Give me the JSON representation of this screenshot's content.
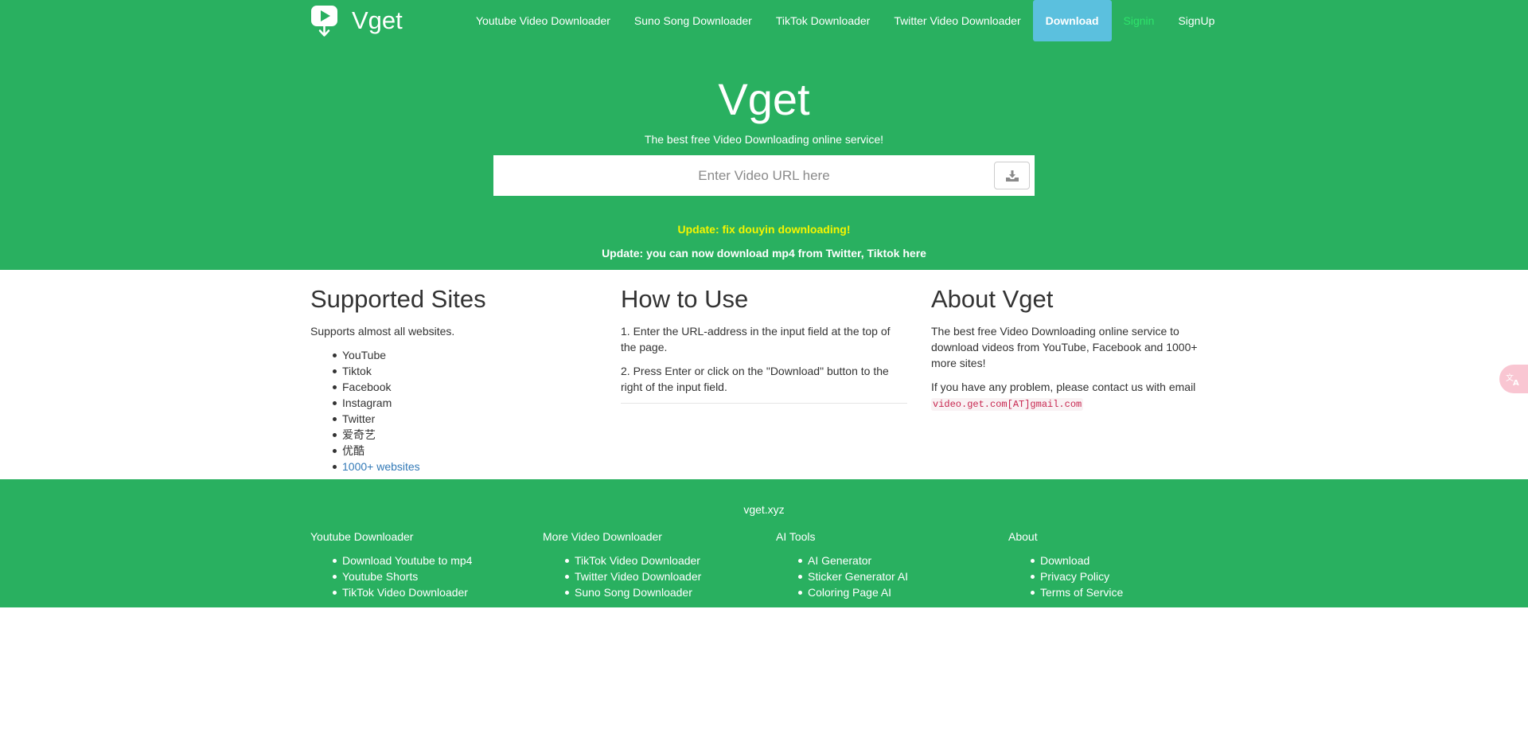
{
  "brand": {
    "name": "Vget",
    "logo_icon": "play-download-icon"
  },
  "nav": {
    "links": [
      "Youtube Video Downloader",
      "Suno Song Downloader",
      "TikTok Downloader",
      "Twitter Video Downloader"
    ],
    "download": "Download",
    "signin": "Signin",
    "signup": "SignUp"
  },
  "hero": {
    "title": "Vget",
    "subtitle": "The best free Video Downloading online service!",
    "search_placeholder": "Enter Video URL here",
    "search_button_icon": "download-tray-icon",
    "update1": "Update: fix douyin downloading!",
    "update2": "Update: you can now download mp4 from Twitter, Tiktok here"
  },
  "supported": {
    "title": "Supported Sites",
    "intro": "Supports almost all websites.",
    "sites": [
      "YouTube",
      "Tiktok",
      "Facebook",
      "Instagram",
      "Twitter",
      "爱奇艺",
      "优酷"
    ],
    "more_link": "1000+ websites"
  },
  "howto": {
    "title": "How to Use",
    "steps": [
      "1. Enter the URL-address in the input field at the top of the page.",
      "2. Press Enter or click on the \"Download\" button to the right of the input field."
    ]
  },
  "about": {
    "title": "About Vget",
    "description": "The best free Video Downloading online service to download videos from YouTube, Facebook and 1000+ more sites!",
    "contact_prefix": "If you have any problem, please contact us with email",
    "email": "video.get.com[AT]gmail.com"
  },
  "translate_icon": "translate-icon",
  "footer": {
    "site": "vget.xyz",
    "columns": [
      {
        "title": "Youtube Downloader",
        "links": [
          "Download Youtube to mp4",
          "Youtube Shorts",
          "TikTok Video Downloader"
        ]
      },
      {
        "title": "More Video Downloader",
        "links": [
          "TikTok Video Downloader",
          "Twitter Video Downloader",
          "Suno Song Downloader"
        ]
      },
      {
        "title": "AI Tools",
        "links": [
          "AI Generator",
          "Sticker Generator AI",
          "Coloring Page AI"
        ]
      },
      {
        "title": "About",
        "links": [
          "Download",
          "Privacy Policy",
          "Terms of Service"
        ]
      }
    ]
  },
  "colors": {
    "brand_green": "#29b060",
    "download_button": "#5bc0de",
    "signin": "#2ee36b",
    "update_yellow": "#f5f500",
    "link_blue": "#337ab7"
  }
}
